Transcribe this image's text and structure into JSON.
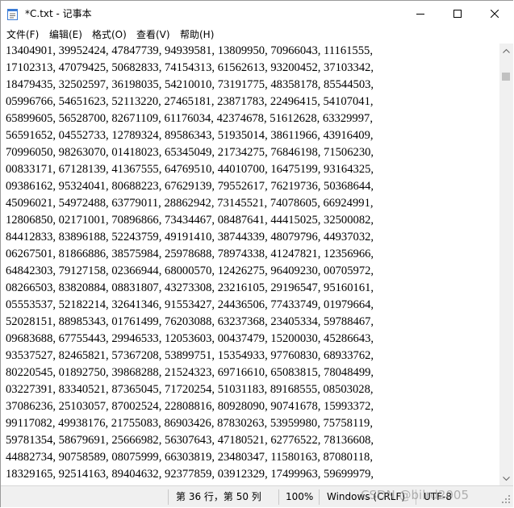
{
  "window": {
    "title": "*C.txt - 记事本",
    "controls": {
      "minimize": "minimize",
      "maximize": "maximize",
      "close": "close"
    }
  },
  "menu": [
    {
      "label": "文件(F)"
    },
    {
      "label": "编辑(E)"
    },
    {
      "label": "格式(O)"
    },
    {
      "label": "查看(V)"
    },
    {
      "label": "帮助(H)"
    }
  ],
  "editor": {
    "lines": [
      "13404901, 39952424, 47847739, 94939581, 13809950, 70966043, 11161555,",
      "17102313, 47079425, 50682833, 74154313, 61562613, 93200452, 37103342,",
      "18479435, 32502597, 36198035, 54210010, 73191775, 48358178, 85544503,",
      "05996766, 54651623, 52113220, 27465181, 23871783, 22496415, 54107041,",
      "65899605, 56528700, 82671109, 61176034, 42374678, 51612628, 63329997,",
      "56591652, 04552733, 12789324, 89586343, 51935014, 38611966, 43916409,",
      "70996050, 98263070, 01418023, 65345049, 21734275, 76846198, 71506230,",
      "00833171, 67128139, 41367555, 64769510, 44010700, 16475199, 93164325,",
      "09386162, 95324041, 80688223, 67629139, 79552617, 76219736, 50368644,",
      "45096021, 54972488, 63779011, 28862942, 73145521, 74078605, 66924991,",
      "12806850, 02171001, 70896866, 73434467, 08487641, 44415025, 32500082,",
      "84412833, 83896188, 52243759, 49191410, 38744339, 48079796, 44937032,",
      "06267501, 81866886, 38575984, 25978688, 78974338, 41247821, 12356966,",
      "64842303, 79127158, 02366944, 68000570, 12426275, 96409230, 00705972,",
      "08266503, 83820884, 08831807, 43273308, 23216105, 29196547, 95160161,",
      "05553537, 52182214, 32641346, 91553427, 24436506, 77433749, 01979664,",
      "52028151, 88985343, 01761499, 76203088, 63237368, 23405334, 59788467,",
      "09683688, 67755443, 29946533, 12053603, 00437479, 15200030, 45286643,",
      "93537527, 82465821, 57367208, 53899751, 15354933, 97760830, 68933762,",
      "80220545, 01892750, 39868288, 21524323, 69716610, 65083815, 78048499,",
      "03227391, 83340521, 87365045, 71720254, 51031183, 89168555, 08503028,",
      "37086236, 25103057, 87002524, 22808816, 80928090, 90741678, 15993372,",
      "99117082, 49938176, 21755083, 86903426, 87830263, 53959980, 75758119,",
      "59781354, 58679691, 25666982, 56307643, 47180521, 62776522, 78136608,",
      "44882734, 90758589, 08075999, 66303819, 23480347, 11580163, 87080118,",
      "18329165, 92514163, 89404632, 92377859, 03912329, 17499963, 59699979,",
      "                                                                      "
    ]
  },
  "statusbar": {
    "position": "第 36 行，第 50 列",
    "zoom": "100%",
    "line_ending": "Windows (CRLF)",
    "encoding": "UTF-8"
  },
  "watermark": "CSDN @bilrd2005"
}
